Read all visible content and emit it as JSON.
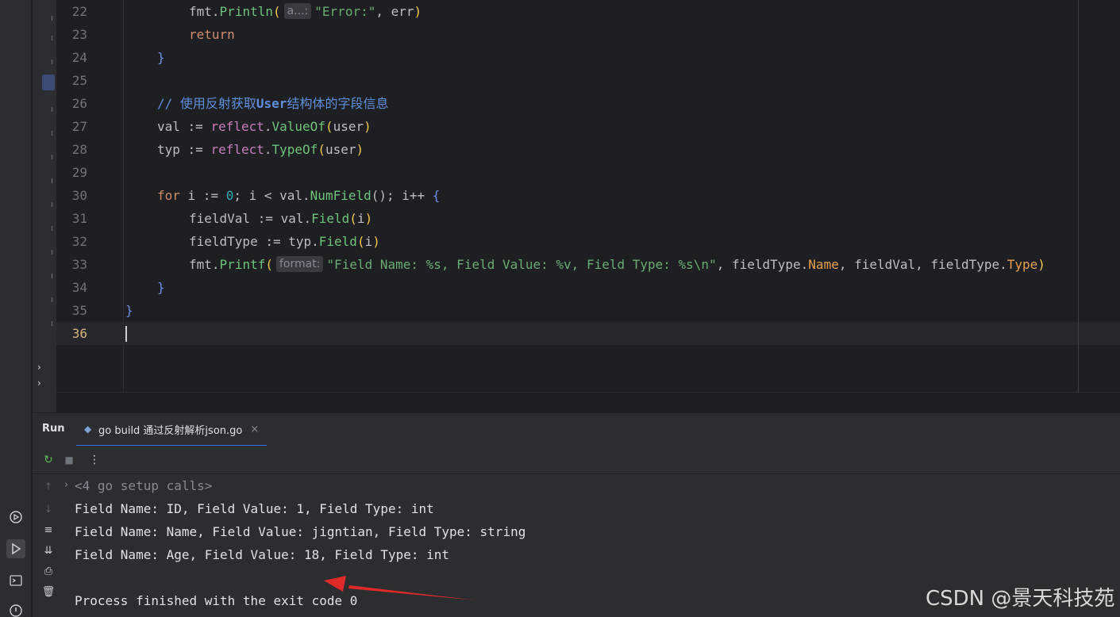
{
  "editor": {
    "lines": [
      {
        "n": "22"
      },
      {
        "n": "23"
      },
      {
        "n": "24"
      },
      {
        "n": "25"
      },
      {
        "n": "26"
      },
      {
        "n": "27"
      },
      {
        "n": "28"
      },
      {
        "n": "29"
      },
      {
        "n": "30"
      },
      {
        "n": "31"
      },
      {
        "n": "32"
      },
      {
        "n": "33"
      },
      {
        "n": "34"
      },
      {
        "n": "35"
      },
      {
        "n": "36"
      }
    ],
    "code": {
      "l22_pkg": "fmt",
      "l22_fn": "Println",
      "l22_hint": "a...:",
      "l22_str": "\"Error:\"",
      "l22_arg": ", err",
      "l23_kw": "return",
      "l24_brace": "}",
      "l26_comment": "// 使用反射获取",
      "l26_comment_bold": "User",
      "l26_comment_end": "结构体的字段信息",
      "l27_var": "val := ",
      "l27_pkg": "reflect",
      "l27_fn": "ValueOf",
      "l27_arg": "user",
      "l28_var": "typ := ",
      "l28_pkg": "reflect",
      "l28_fn": "TypeOf",
      "l28_arg": "user",
      "l30_kw": "for",
      "l30_a": " i := ",
      "l30_num": "0",
      "l30_b": "; i < val.",
      "l30_fn": "NumField",
      "l30_c": "(); i++ ",
      "l30_brace": "{",
      "l31_var": "fieldVal := val.",
      "l31_fn": "Field",
      "l31_arg": "i",
      "l32_var": "fieldType := typ.",
      "l32_fn": "Field",
      "l32_arg": "i",
      "l33_pkg": "fmt",
      "l33_fn": "Printf",
      "l33_hint": "format:",
      "l33_str": "\"Field Name: %s, Field Value: %v, Field Type: %s\\n\"",
      "l33_a": ", fieldType.",
      "l33_f1": "Name",
      "l33_b": ", fieldVal, fieldType.",
      "l33_f2": "Type",
      "l34_brace": "}",
      "l35_brace": "}"
    }
  },
  "run": {
    "title": "Run",
    "tab_label": "go build 通过反射解析json.go",
    "tab_close": "×",
    "toolbar": {
      "rerun": "↻",
      "stop": "■",
      "more": "⋮"
    },
    "output": [
      "<4 go setup calls>",
      "Field Name: ID, Field Value: 1, Field Type: int",
      "Field Name: Name, Field Value: jigntian, Field Type: string",
      "Field Name: Age, Field Value: 18, Field Type: int",
      "",
      "Process finished with the exit code 0"
    ]
  },
  "watermark": "CSDN @景天科技苑",
  "colors": {
    "accent": "#3574f0",
    "arrow": "#e02a2a",
    "keyword": "#cf8e6d",
    "string": "#6aab73"
  }
}
